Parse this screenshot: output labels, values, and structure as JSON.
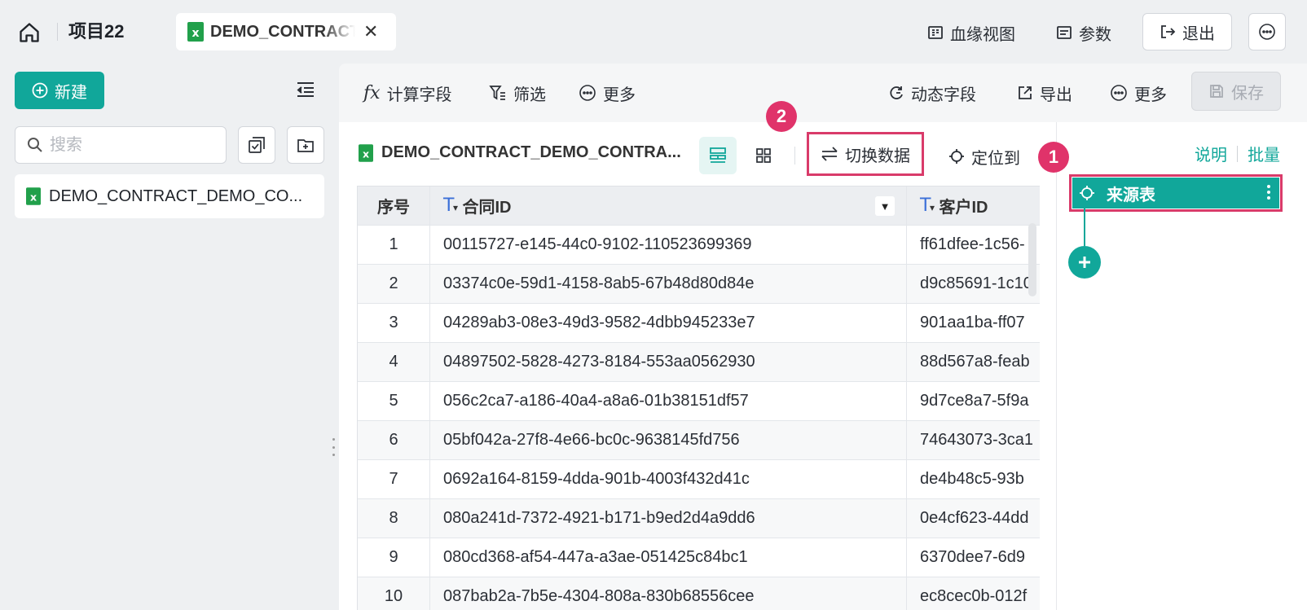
{
  "header": {
    "project_title": "项目22",
    "file_tab_label": "DEMO_CONTRACT_DEMO_CONTRACT",
    "actions": {
      "lineage": "血缘视图",
      "params": "参数",
      "exit": "退出"
    }
  },
  "sidebar": {
    "new_label": "新建",
    "search_placeholder": "搜索",
    "file_label": "DEMO_CONTRACT_DEMO_CO..."
  },
  "toolbar": {
    "calc_field": "计算字段",
    "filter": "筛选",
    "more_left": "更多",
    "dynamic_field": "动态字段",
    "export": "导出",
    "more_right": "更多",
    "save": "保存"
  },
  "dataset": {
    "title": "DEMO_CONTRACT_DEMO_CONTRA...",
    "switch_data": "切换数据",
    "locate": "定位到"
  },
  "badges": {
    "one": "1",
    "two": "2"
  },
  "table": {
    "headers": {
      "index": "序号",
      "contract_id": "合同ID",
      "customer_id": "客户ID"
    },
    "rows": [
      {
        "idx": "1",
        "contract_id": "00115727-e145-44c0-9102-110523699369",
        "customer_id": "ff61dfee-1c56-"
      },
      {
        "idx": "2",
        "contract_id": "03374c0e-59d1-4158-8ab5-67b48d80d84e",
        "customer_id": "d9c85691-1c10"
      },
      {
        "idx": "3",
        "contract_id": "04289ab3-08e3-49d3-9582-4dbb945233e7",
        "customer_id": "901aa1ba-ff07"
      },
      {
        "idx": "4",
        "contract_id": "04897502-5828-4273-8184-553aa0562930",
        "customer_id": "88d567a8-feab"
      },
      {
        "idx": "5",
        "contract_id": "056c2ca7-a186-40a4-a8a6-01b38151df57",
        "customer_id": "9d7ce8a7-5f9a"
      },
      {
        "idx": "6",
        "contract_id": "05bf042a-27f8-4e66-bc0c-9638145fd756",
        "customer_id": "74643073-3ca1"
      },
      {
        "idx": "7",
        "contract_id": "0692a164-8159-4dda-901b-4003f432d41c",
        "customer_id": "de4b48c5-93b"
      },
      {
        "idx": "8",
        "contract_id": "080a241d-7372-4921-b171-b9ed2d4a9dd6",
        "customer_id": "0e4cf623-44dd"
      },
      {
        "idx": "9",
        "contract_id": "080cd368-af54-447a-a3ae-051425c84bc1",
        "customer_id": "6370dee7-6d9"
      },
      {
        "idx": "10",
        "contract_id": "087bab2a-7b5e-4304-808a-830b68556cee",
        "customer_id": "ec8cec0b-012f"
      }
    ]
  },
  "right_panel": {
    "explain": "说明",
    "batch": "批量",
    "node_label": "来源表"
  },
  "colors": {
    "accent": "#11a79a",
    "highlight": "#d93b6a",
    "badge": "#e0336a"
  },
  "icons": [
    "home-icon",
    "excel-icon",
    "close-icon",
    "lineage-icon",
    "params-icon",
    "exit-icon",
    "more-icon",
    "plus-circle-icon",
    "collapse-icon",
    "search-icon",
    "checkbox-icon",
    "folder-add-icon",
    "fx-icon",
    "filter-icon",
    "dynamic-field-icon",
    "export-icon",
    "save-icon",
    "table-view-icon",
    "grid-view-icon",
    "switch-icon",
    "locate-icon",
    "text-type-icon"
  ]
}
